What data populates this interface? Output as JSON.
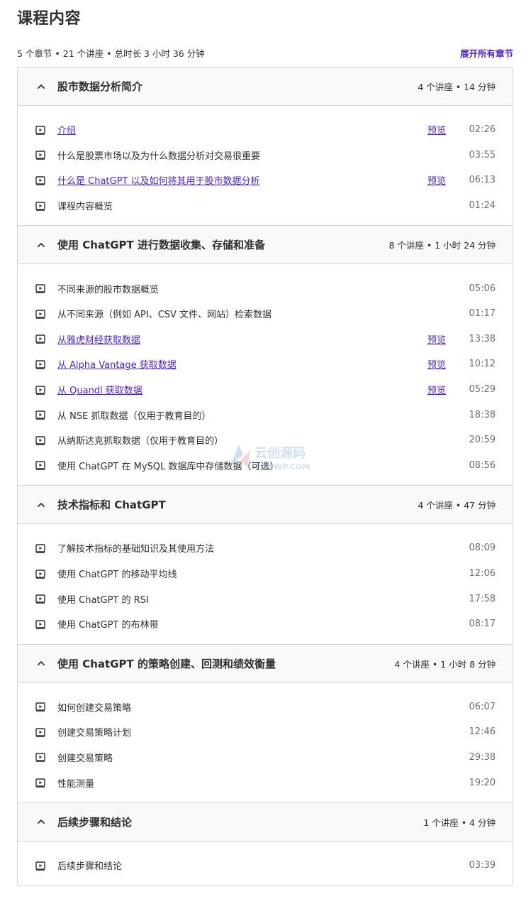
{
  "page": {
    "title": "课程内容",
    "summary": "5 个章节 • 21 个讲座 • 总时长 3 小时 36 分钟",
    "expand_all": "展开所有章节",
    "preview_label": "预览"
  },
  "icons": {
    "chevron": "chevron-up-icon",
    "lecture": "play-video-icon"
  },
  "colors": {
    "link": "#5022c3",
    "text": "#2d2f31",
    "muted": "#6a6f73",
    "header_bg": "#f7f9fa",
    "border": "#d1d7dc"
  },
  "sections": [
    {
      "title": "股市数据分析简介",
      "meta": "4 个讲座 • 14 分钟",
      "lectures": [
        {
          "title": "介绍",
          "duration": "02:26",
          "preview": true
        },
        {
          "title": "什么是股票市场以及为什么数据分析对交易很重要",
          "duration": "03:55",
          "preview": false
        },
        {
          "title": "什么是 ChatGPT 以及如何将其用于股市数据分析",
          "duration": "06:13",
          "preview": true
        },
        {
          "title": "课程内容概览",
          "duration": "01:24",
          "preview": false
        }
      ]
    },
    {
      "title": "使用 ChatGPT 进行数据收集、存储和准备",
      "meta": "8 个讲座 • 1 小时 24 分钟",
      "lectures": [
        {
          "title": "不同来源的股市数据概览",
          "duration": "05:06",
          "preview": false
        },
        {
          "title": "从不同来源（例如 API、CSV 文件、网站）检索数据",
          "duration": "01:17",
          "preview": false
        },
        {
          "title": "从雅虎财经获取数据",
          "duration": "13:38",
          "preview": true
        },
        {
          "title": "从 Alpha Vantage 获取数据",
          "duration": "10:12",
          "preview": true
        },
        {
          "title": "从 Quandl 获取数据",
          "duration": "05:29",
          "preview": true
        },
        {
          "title": "从 NSE 抓取数据（仅用于教育目的）",
          "duration": "18:38",
          "preview": false
        },
        {
          "title": "从纳斯达克抓取数据（仅用于教育目的）",
          "duration": "20:59",
          "preview": false
        },
        {
          "title": "使用 ChatGPT 在 MySQL 数据库中存储数据（可选）",
          "duration": "08:56",
          "preview": false
        }
      ]
    },
    {
      "title": "技术指标和 ChatGPT",
      "meta": "4 个讲座 • 47 分钟",
      "lectures": [
        {
          "title": "了解技术指标的基础知识及其使用方法",
          "duration": "08:09",
          "preview": false
        },
        {
          "title": "使用 ChatGPT 的移动平均线",
          "duration": "12:06",
          "preview": false
        },
        {
          "title": "使用 ChatGPT 的 RSI",
          "duration": "17:58",
          "preview": false
        },
        {
          "title": "使用 ChatGPT 的布林带",
          "duration": "08:17",
          "preview": false
        }
      ]
    },
    {
      "title": "使用 ChatGPT 的策略创建、回测和绩效衡量",
      "meta": "4 个讲座 • 1 小时 8 分钟",
      "lectures": [
        {
          "title": "如何创建交易策略",
          "duration": "06:07",
          "preview": false
        },
        {
          "title": "创建交易策略计划",
          "duration": "12:46",
          "preview": false
        },
        {
          "title": "创建交易策略",
          "duration": "29:38",
          "preview": false
        },
        {
          "title": "性能测量",
          "duration": "19:20",
          "preview": false
        }
      ]
    },
    {
      "title": "后续步骤和结论",
      "meta": "1 个讲座 • 4 分钟",
      "lectures": [
        {
          "title": "后续步骤和结论",
          "duration": "03:39",
          "preview": false
        }
      ]
    }
  ],
  "watermark": {
    "brand": "云创源码",
    "domain": "LOOWP.COM"
  }
}
